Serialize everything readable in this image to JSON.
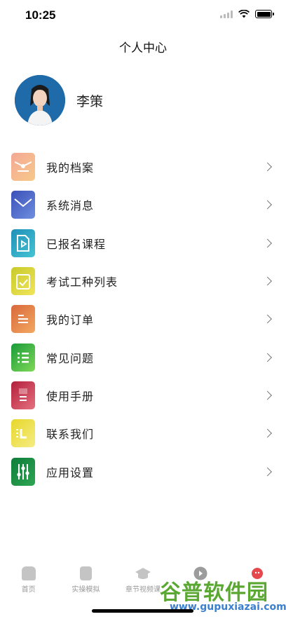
{
  "status_bar": {
    "time": "10:25"
  },
  "header": {
    "title": "个人中心"
  },
  "profile": {
    "name": "李策"
  },
  "menu": [
    {
      "label": "我的档案",
      "icon": "profile-card-icon",
      "colors": [
        "#f4a896",
        "#f7c98a"
      ]
    },
    {
      "label": "系统消息",
      "icon": "envelope-icon",
      "colors": [
        "#3b4fb7",
        "#6d8fe0"
      ]
    },
    {
      "label": "已报名课程",
      "icon": "video-file-icon",
      "colors": [
        "#1f8fb8",
        "#45c4d3"
      ]
    },
    {
      "label": "考试工种列表",
      "icon": "clipboard-check-icon",
      "colors": [
        "#c8c92a",
        "#f1e55a"
      ]
    },
    {
      "label": "我的订单",
      "icon": "document-icon",
      "colors": [
        "#d9683b",
        "#f3a861"
      ]
    },
    {
      "label": "常见问题",
      "icon": "list-icon",
      "colors": [
        "#1a9a3a",
        "#7ed957"
      ]
    },
    {
      "label": "使用手册",
      "icon": "manual-icon",
      "colors": [
        "#b31f3b",
        "#e5717f"
      ]
    },
    {
      "label": "联系我们",
      "icon": "contact-icon",
      "colors": [
        "#e6d72b",
        "#f6ec84"
      ]
    },
    {
      "label": "应用设置",
      "icon": "sliders-icon",
      "colors": [
        "#0e7d3a",
        "#2fa552"
      ]
    }
  ],
  "tabbar": [
    {
      "label": "首页",
      "icon": "home-icon"
    },
    {
      "label": "实操模拟",
      "icon": "book-icon"
    },
    {
      "label": "章节视频课",
      "icon": "graduation-cap-icon"
    },
    {
      "label": "",
      "icon": "play-icon"
    },
    {
      "label": "",
      "icon": "user-icon"
    }
  ],
  "watermark": {
    "text": "谷普软件园",
    "url": "www.gupuxiazai.com"
  }
}
